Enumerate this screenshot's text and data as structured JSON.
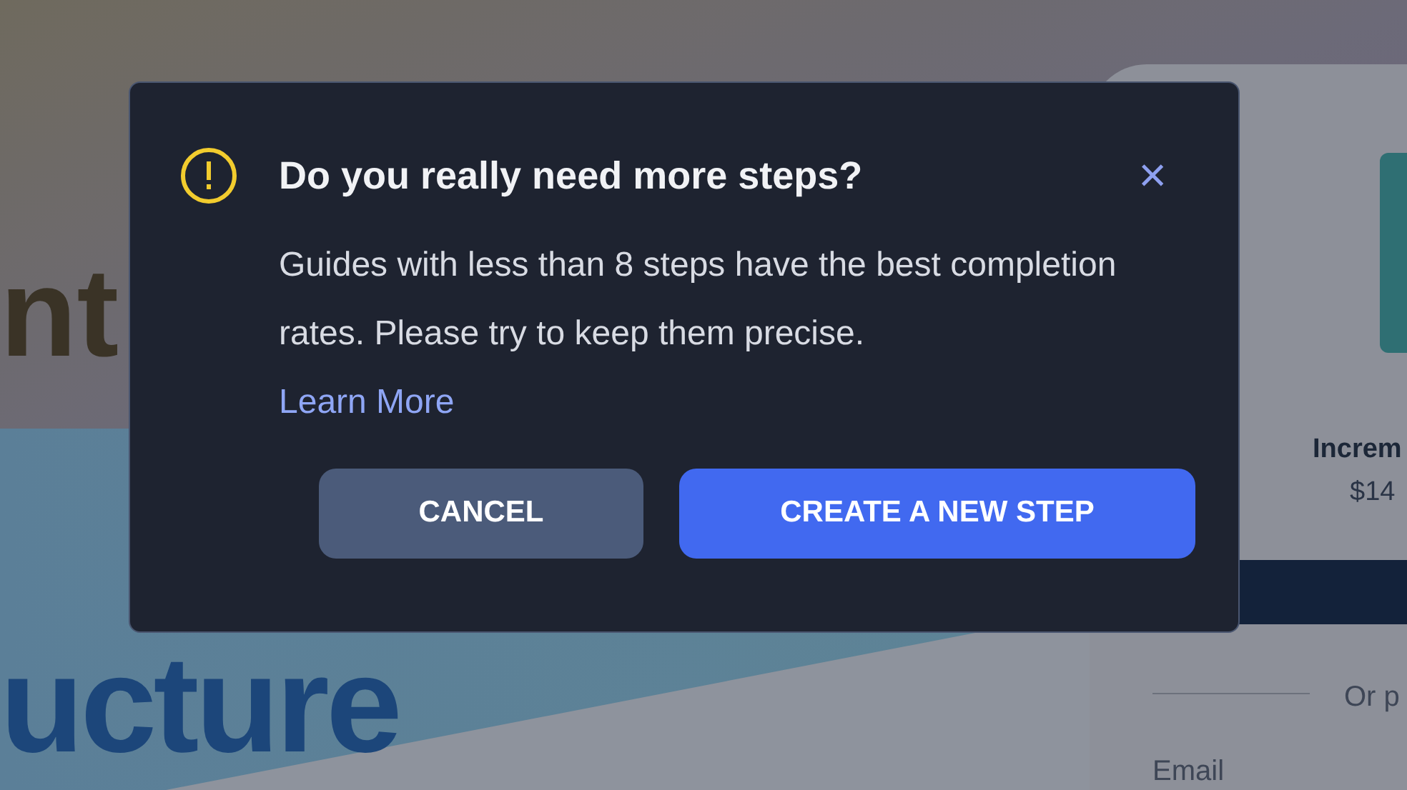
{
  "background": {
    "headline_top": "nt",
    "headline_bottom": "ucture",
    "product": {
      "title": "Increm",
      "price": "$14"
    },
    "divider_label": "Or p",
    "email_label": "Email"
  },
  "dialog": {
    "title": "Do you really need more steps?",
    "close": "×",
    "message": "Guides with less than 8 steps have the best completion rates. Please try to keep them precise.",
    "link": "Learn More",
    "buttons": [
      {
        "label": "CANCEL",
        "kind": "secondary"
      },
      {
        "label": "CREATE A NEW STEP",
        "kind": "primary"
      }
    ]
  }
}
